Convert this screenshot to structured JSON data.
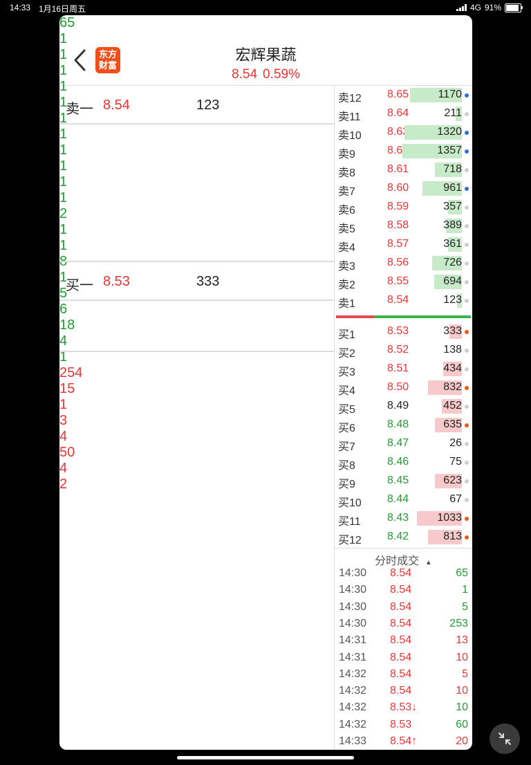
{
  "status_bar": {
    "time": "14:33",
    "date": "1月16日周五",
    "network": "4G",
    "battery": "91%"
  },
  "header": {
    "title": "宏辉果蔬",
    "price": "8.54",
    "change": "0.59%",
    "logo_text": "东方财富"
  },
  "sell_one": {
    "label": "卖一",
    "price": "8.54",
    "qty": "123"
  },
  "sell_queue": [
    [
      "65",
      "1",
      "1",
      "1",
      "1"
    ],
    [
      "1",
      "1",
      "1",
      "1",
      "1"
    ],
    [
      "1",
      "1",
      "2",
      "1",
      "1"
    ],
    [
      "8",
      "1",
      "5",
      "6",
      "18"
    ],
    [
      "4",
      "1"
    ]
  ],
  "buy_one": {
    "label": "买一",
    "price": "8.53",
    "qty": "333"
  },
  "buy_queue": [
    [
      "254",
      "15",
      "1",
      "3",
      "4"
    ],
    [
      "50",
      "4",
      "2"
    ]
  ],
  "depth_sell": [
    {
      "label": "卖12",
      "price": "8.65",
      "vol": "1170",
      "bar": 0.58,
      "dot": "blue"
    },
    {
      "label": "卖11",
      "price": "8.64",
      "vol": "211",
      "bar": 0.07,
      "dot": "gray"
    },
    {
      "label": "卖10",
      "price": "8.63",
      "vol": "1320",
      "bar": 0.64,
      "dot": "blue"
    },
    {
      "label": "卖9",
      "price": "8.62",
      "vol": "1357",
      "bar": 0.66,
      "dot": "blue"
    },
    {
      "label": "卖8",
      "price": "8.61",
      "vol": "718",
      "bar": 0.3,
      "dot": "gray"
    },
    {
      "label": "卖7",
      "price": "8.60",
      "vol": "961",
      "bar": 0.44,
      "dot": "blue"
    },
    {
      "label": "卖6",
      "price": "8.59",
      "vol": "357",
      "bar": 0.15,
      "dot": "gray"
    },
    {
      "label": "卖5",
      "price": "8.58",
      "vol": "389",
      "bar": 0.18,
      "dot": "gray"
    },
    {
      "label": "卖4",
      "price": "8.57",
      "vol": "361",
      "bar": 0.15,
      "dot": "gray"
    },
    {
      "label": "卖3",
      "price": "8.56",
      "vol": "726",
      "bar": 0.33,
      "dot": "gray"
    },
    {
      "label": "卖2",
      "price": "8.55",
      "vol": "694",
      "bar": 0.31,
      "dot": "gray"
    },
    {
      "label": "卖1",
      "price": "8.54",
      "vol": "123",
      "bar": 0.05,
      "dot": "gray"
    }
  ],
  "depth_buy": [
    {
      "label": "买1",
      "price": "8.53",
      "vol": "333",
      "bar": 0.14,
      "dot": "orange",
      "pc": "red"
    },
    {
      "label": "买2",
      "price": "8.52",
      "vol": "138",
      "bar": 0.0,
      "dot": "gray",
      "pc": "red"
    },
    {
      "label": "买3",
      "price": "8.51",
      "vol": "434",
      "bar": 0.21,
      "dot": "gray",
      "pc": "red"
    },
    {
      "label": "买4",
      "price": "8.50",
      "vol": "832",
      "bar": 0.38,
      "dot": "orange",
      "pc": "red"
    },
    {
      "label": "买5",
      "price": "8.49",
      "vol": "452",
      "bar": 0.22,
      "dot": "gray",
      "pc": "dark"
    },
    {
      "label": "买6",
      "price": "8.48",
      "vol": "635",
      "bar": 0.3,
      "dot": "orange",
      "pc": "green"
    },
    {
      "label": "买7",
      "price": "8.47",
      "vol": "26",
      "bar": 0.0,
      "dot": "gray",
      "pc": "green"
    },
    {
      "label": "买8",
      "price": "8.46",
      "vol": "75",
      "bar": 0.0,
      "dot": "gray",
      "pc": "green"
    },
    {
      "label": "买9",
      "price": "8.45",
      "vol": "623",
      "bar": 0.3,
      "dot": "gray",
      "pc": "green"
    },
    {
      "label": "买10",
      "price": "8.44",
      "vol": "67",
      "bar": 0.0,
      "dot": "gray",
      "pc": "green"
    },
    {
      "label": "买11",
      "price": "8.43",
      "vol": "1033",
      "bar": 0.5,
      "dot": "orange",
      "pc": "green"
    },
    {
      "label": "买12",
      "price": "8.42",
      "vol": "813",
      "bar": 0.38,
      "dot": "orange",
      "pc": "green"
    }
  ],
  "trades_header": "分时成交",
  "trades": [
    {
      "time": "14:30",
      "price": "8.54",
      "vol": "65",
      "vc": "green"
    },
    {
      "time": "14:30",
      "price": "8.54",
      "vol": "1",
      "vc": "green"
    },
    {
      "time": "14:30",
      "price": "8.54",
      "vol": "5",
      "vc": "green"
    },
    {
      "time": "14:30",
      "price": "8.54",
      "vol": "253",
      "vc": "green"
    },
    {
      "time": "14:31",
      "price": "8.54",
      "vol": "13",
      "vc": "red"
    },
    {
      "time": "14:31",
      "price": "8.54",
      "vol": "10",
      "vc": "red"
    },
    {
      "time": "14:32",
      "price": "8.54",
      "vol": "5",
      "vc": "red"
    },
    {
      "time": "14:32",
      "price": "8.54",
      "vol": "10",
      "vc": "red"
    },
    {
      "time": "14:32",
      "price": "8.53↓",
      "vol": "10",
      "vc": "green"
    },
    {
      "time": "14:32",
      "price": "8.53",
      "vol": "60",
      "vc": "green"
    },
    {
      "time": "14:33",
      "price": "8.54↑",
      "vol": "20",
      "vc": "red"
    }
  ],
  "colors": {
    "up": "#e33",
    "down": "#1e9e2e",
    "sell_bar": "#c7ebc9",
    "buy_bar": "#f7c9cb",
    "dot_blue": "#2f6fd6",
    "dot_gray": "#cfcfcf",
    "dot_orange": "#ea5a12"
  }
}
